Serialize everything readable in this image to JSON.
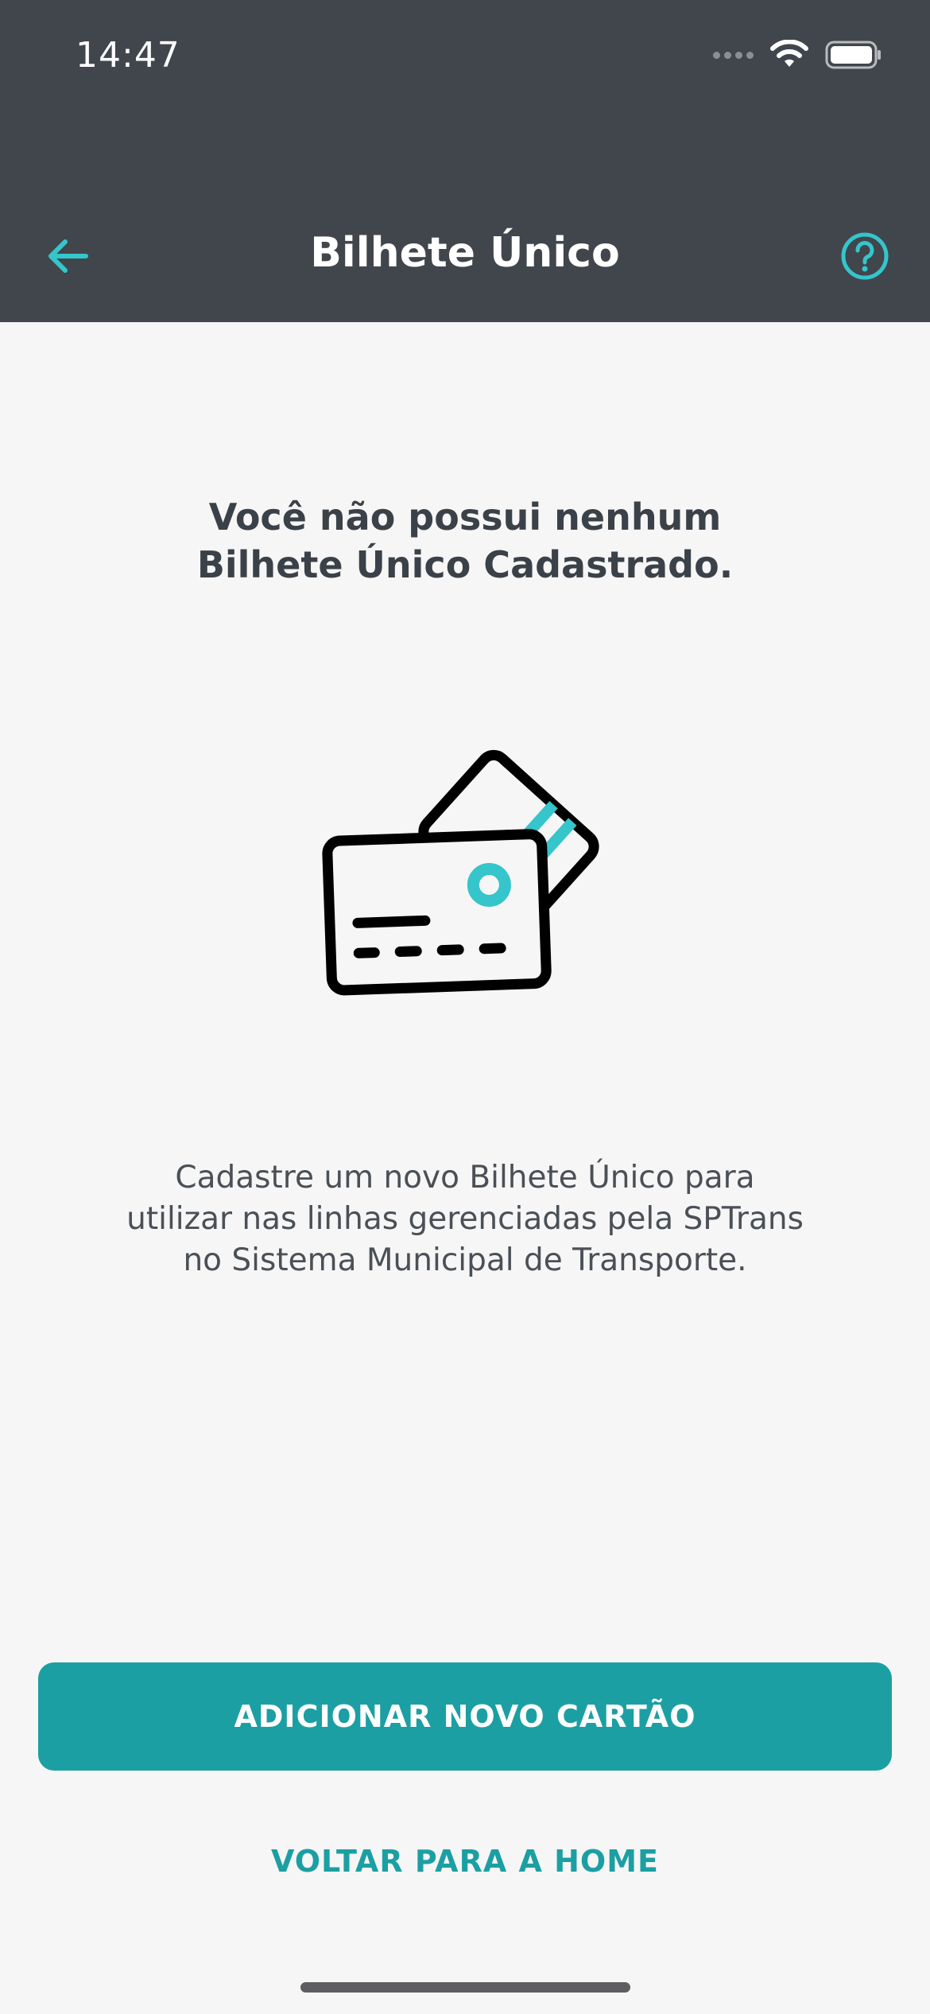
{
  "status_bar": {
    "time": "14:47"
  },
  "nav": {
    "title": "Bilhete Único",
    "back_icon": "arrow-left-icon",
    "help_icon": "help-circle-icon"
  },
  "empty_state": {
    "headline_line1": "Você não possui nenhum",
    "headline_line2": "Bilhete Único Cadastrado.",
    "illustration_icon": "cards-icon",
    "description_line1": "Cadastre um novo Bilhete Único para",
    "description_line2": "utilizar nas linhas gerenciadas pela SPTrans",
    "description_line3": "no Sistema Municipal de Transporte."
  },
  "actions": {
    "primary_label": "ADICIONAR NOVO CARTÃO",
    "secondary_label": "VOLTAR PARA A HOME"
  },
  "colors": {
    "header_bg": "#40464c",
    "accent": "#1c9fa3",
    "icon_accent": "#35c5cb",
    "background": "#f6f6f6"
  }
}
